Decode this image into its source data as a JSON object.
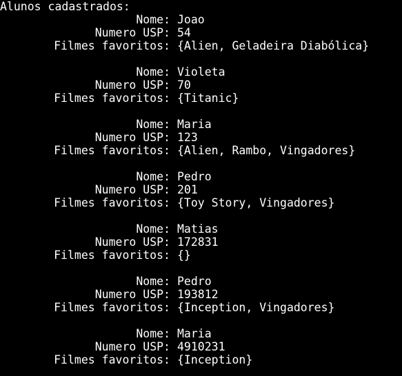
{
  "terminal": {
    "header": "Alunos cadastrados:",
    "labels": {
      "name": "Nome:",
      "usp": "Numero USP:",
      "films": "Filmes favoritos:"
    },
    "students": [
      {
        "name": "Joao",
        "usp": "54",
        "films": "{Alien, Geladeira Diabólica}"
      },
      {
        "name": "Violeta",
        "usp": "70",
        "films": "{Titanic}"
      },
      {
        "name": "Maria",
        "usp": "123",
        "films": "{Alien, Rambo, Vingadores}"
      },
      {
        "name": "Pedro",
        "usp": "201",
        "films": "{Toy Story, Vingadores}"
      },
      {
        "name": "Matias",
        "usp": "172831",
        "films": "{}"
      },
      {
        "name": "Pedro",
        "usp": "193812",
        "films": "{Inception, Vingadores}"
      },
      {
        "name": "Maria",
        "usp": "4910231",
        "films": "{Inception}"
      }
    ]
  },
  "colors": {
    "background": "#000000",
    "text": "#ffffff"
  }
}
